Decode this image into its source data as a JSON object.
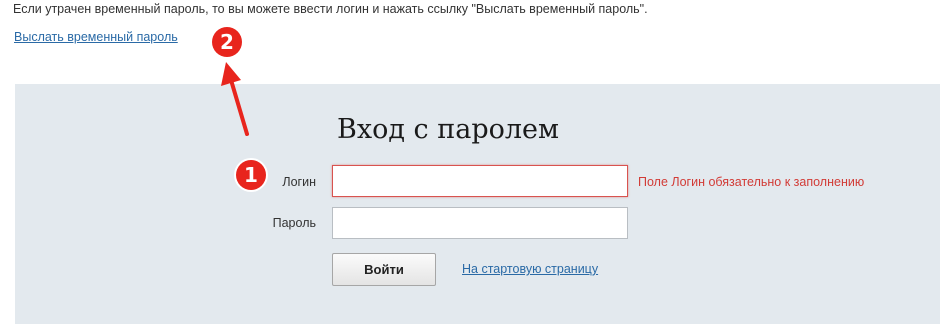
{
  "header": {
    "info_text": "Если утрачен временный пароль, то вы можете ввести логин и нажать ссылку \"Выслать временный пароль\".",
    "send_temp_password_link": "Выслать временный пароль"
  },
  "login_form": {
    "title": "Вход с паролем",
    "login_label": "Логин",
    "login_value": "",
    "login_error": "Поле Логин обязательно к заполнению",
    "password_label": "Пароль",
    "password_value": "",
    "submit_label": "Войти",
    "home_link": "На стартовую страницу"
  },
  "annotations": {
    "marker_1": "1",
    "marker_2": "2",
    "marker_color": "#e8251d"
  },
  "colors": {
    "panel_background": "#e3e9ee",
    "link": "#2a6aa6",
    "error": "#d23b36"
  }
}
